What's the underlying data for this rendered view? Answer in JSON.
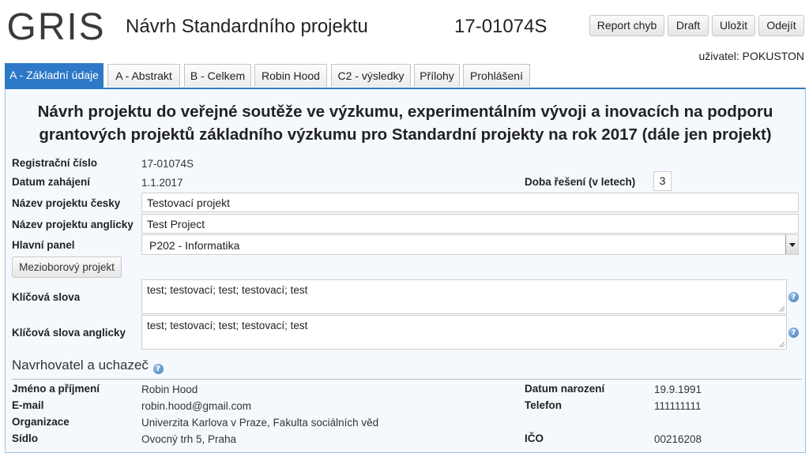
{
  "header": {
    "logo_text": "GRIS",
    "title": "Návrh Standardního projektu",
    "project_code": "17-01074S",
    "buttons": {
      "report": "Report chyb",
      "draft": "Draft",
      "save": "Uložit",
      "logout": "Odejít"
    },
    "user_line": "uživatel: POKUSTON"
  },
  "tabs": [
    {
      "label": "A - Základní údaje",
      "active": true
    },
    {
      "label": "A - Abstrakt"
    },
    {
      "label": "B - Celkem"
    },
    {
      "label": "Robin Hood"
    },
    {
      "label": "C2 - výsledky"
    },
    {
      "label": "Přílohy"
    },
    {
      "label": "Prohlášení"
    }
  ],
  "main": {
    "heading_line1": "Návrh projektu do veřejné soutěže ve výzkumu, experimentálním vývoji a inovacích na podporu",
    "heading_line2": "grantových projektů základního výzkumu pro Standardní projekty na rok 2017 (dále jen projekt)",
    "reg_label": "Registrační číslo",
    "reg_value": "17-01074S",
    "start_label": "Datum zahájení",
    "start_value": "1.1.2017",
    "duration_label": "Doba řešení (v letech)",
    "duration_value": "3",
    "name_cz_label": "Název projektu česky",
    "name_cz_value": "Testovací projekt",
    "name_en_label": "Název projektu anglicky",
    "name_en_value": "Test Project",
    "panel_label": "Hlavní panel",
    "panel_value": "P202 - Informatika",
    "mezioborovy_button": "Mezioborový projekt",
    "keywords_label": "Klíčová slova",
    "keywords_value": "test; testovací; test; testovací; test",
    "keywords_en_label": "Klíčová slova anglicky",
    "keywords_en_value": "test; testovací; test; testovací; test"
  },
  "applicant": {
    "section_title": "Navrhovatel a uchazeč",
    "name_label": "Jméno a příjmení",
    "name_value": "Robin Hood",
    "email_label": "E-mail",
    "email_value": "robin.hood@gmail.com",
    "org_label": "Organizace",
    "org_value": "Univerzita Karlova v Praze, Fakulta sociálních věd",
    "seat_label": "Sídlo",
    "seat_value": "Ovocný trh 5, Praha",
    "birth_label": "Datum narození",
    "birth_value": "19.9.1991",
    "phone_label": "Telefon",
    "phone_value": "111111111",
    "ico_label": "IČO",
    "ico_value": "00216208"
  },
  "colors": {
    "accent": "#2d79c7",
    "content_bg": "#f5f9fe"
  }
}
